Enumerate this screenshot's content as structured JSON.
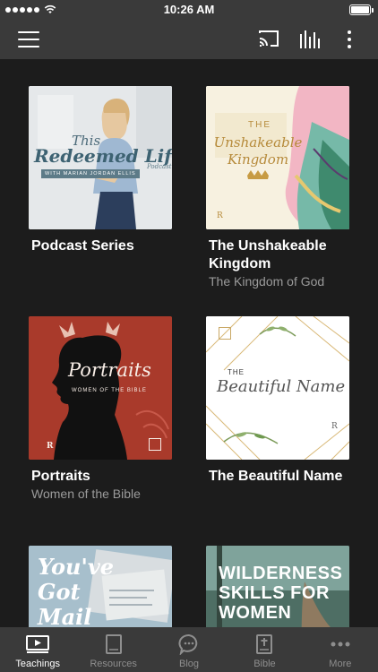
{
  "status_bar": {
    "time": "10:26 AM"
  },
  "grid": {
    "items": [
      {
        "title": "Podcast Series",
        "subtitle": "",
        "cover": {
          "heading_top": "This",
          "heading_main": "Redeemed Life.",
          "host_line": "WITH MARIAN JORDAN ELLIS",
          "badge": "Podcast"
        }
      },
      {
        "title": "The Unshakeable Kingdom",
        "subtitle": "The Kingdom of God",
        "cover": {
          "heading_top": "THE",
          "heading_main": "Unshakeable Kingdom",
          "logo": "R"
        }
      },
      {
        "title": "Portraits",
        "subtitle": "Women of the Bible",
        "cover": {
          "heading_main": "Portraits",
          "heading_sub": "WOMEN OF THE BIBLE",
          "logo": "R"
        }
      },
      {
        "title": "The Beautiful Name",
        "subtitle": "",
        "cover": {
          "heading_top": "THE",
          "heading_main": "Beautiful Name",
          "logo": "R"
        }
      },
      {
        "title": "",
        "subtitle": "",
        "cover": {
          "heading_main": "You've Got Mail"
        }
      },
      {
        "title": "",
        "subtitle": "",
        "cover": {
          "line1": "WILDERNESS",
          "line2": "SKILLS FOR",
          "line3": "WOMEN"
        }
      }
    ]
  },
  "tab_bar": {
    "tabs": [
      {
        "label": "Teachings",
        "icon": "play-icon",
        "active": true
      },
      {
        "label": "Resources",
        "icon": "book-icon",
        "active": false
      },
      {
        "label": "Blog",
        "icon": "chat-bubble-icon",
        "active": false
      },
      {
        "label": "Bible",
        "icon": "bible-icon",
        "active": false
      },
      {
        "label": "More",
        "icon": "more-horizontal-icon",
        "active": false
      }
    ]
  },
  "colors": {
    "bar_bg": "#3a3a3a",
    "content_bg": "#1c1c1c",
    "subtitle": "#9b9b9b",
    "portraits_red": "#a93a2b"
  }
}
